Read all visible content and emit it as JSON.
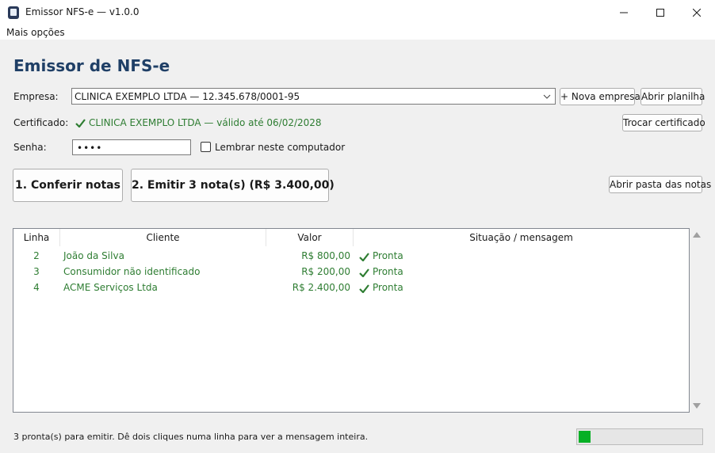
{
  "window": {
    "title": "Emissor NFS-e — v1.0.0"
  },
  "menu": {
    "items": [
      "Mais opções"
    ]
  },
  "main": {
    "heading": "Emissor de NFS-e",
    "empresa_label": "Empresa:",
    "empresa_value": "CLINICA EXEMPLO LTDA — 12.345.678/0001-95",
    "nova_empresa_button": "+ Nova empresa",
    "abrir_planilha_button": "Abrir planilha",
    "certificado_label": "Certificado:",
    "certificado_status": "CLINICA EXEMPLO LTDA — válido até 06/02/2028",
    "trocar_certificado_button": "Trocar certificado",
    "senha_label": "Senha:",
    "senha_value": "••••",
    "lembrar_label": "Lembrar neste computador",
    "lembrar_checked": false,
    "conferir_button": "1. Conferir notas",
    "emitir_button": "2. Emitir 3 nota(s) (R$ 3.400,00)",
    "abrir_pasta_button": "Abrir pasta das notas"
  },
  "table": {
    "columns": [
      "Linha",
      "Cliente",
      "Valor",
      "Situação / mensagem"
    ],
    "rows": [
      {
        "linha": "2",
        "cliente": "João da Silva",
        "valor": "R$ 800,00",
        "situacao": "Pronta"
      },
      {
        "linha": "3",
        "cliente": "Consumidor não identificado",
        "valor": "R$ 200,00",
        "situacao": "Pronta"
      },
      {
        "linha": "4",
        "cliente": "ACME Serviços Ltda",
        "valor": "R$ 2.400,00",
        "situacao": "Pronta"
      }
    ]
  },
  "status": {
    "text": "3 pronta(s) para emitir.  Dê dois cliques numa linha para ver a mensagem inteira.",
    "progress_fraction": 0.1
  },
  "colors": {
    "heading": "#1f3f66",
    "success": "#2e7d32",
    "progress": "#06b025"
  },
  "icons": {
    "status_ok": "check-icon",
    "combo": "chevron-down-icon"
  }
}
